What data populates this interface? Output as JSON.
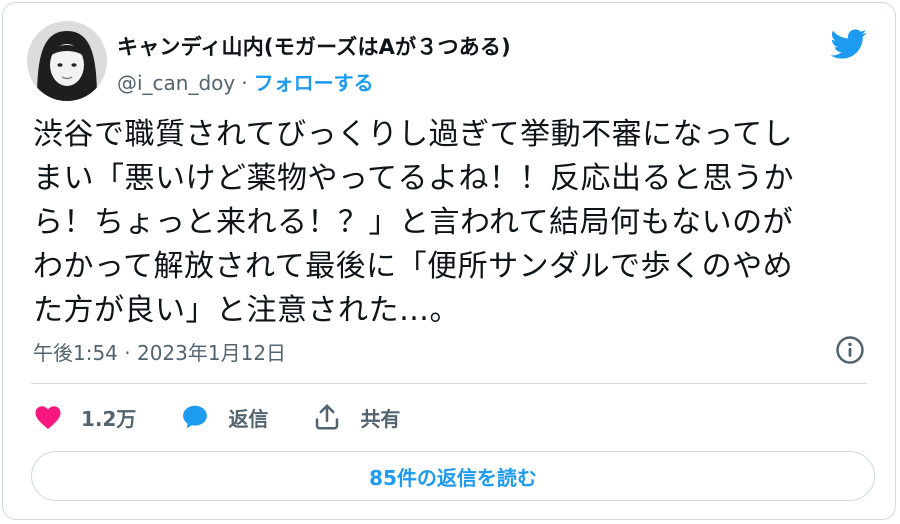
{
  "author": {
    "name": "キャンディ山内(モガーズはAが３つある)",
    "handle": "@i_can_doy",
    "separator": "·",
    "follow_label": "フォローする"
  },
  "tweet": {
    "lines": [
      "渋谷で職質されてびっくりし過ぎて挙動不審になってし",
      "まい「悪いけど薬物やってるよね！！反応出ると思うか",
      "ら！ちょっと来れる！？」と言われて結局何もないのが",
      "わかって解放されて最後に「便所サンダルで歩くのやめ",
      "た方が良い」と注意された…。"
    ],
    "timestamp": "午後1:54 · 2023年1月12日"
  },
  "actions": {
    "like_count": "1.2万",
    "reply_label": "返信",
    "share_label": "共有"
  },
  "replies_button": "85件の返信を読む",
  "colors": {
    "accent": "#1d9bf0",
    "like": "#f91880",
    "muted": "#536471",
    "border": "#cfd9de"
  },
  "icons": [
    "twitter-bird-icon",
    "info-icon",
    "heart-icon",
    "reply-bubble-icon",
    "share-icon"
  ]
}
